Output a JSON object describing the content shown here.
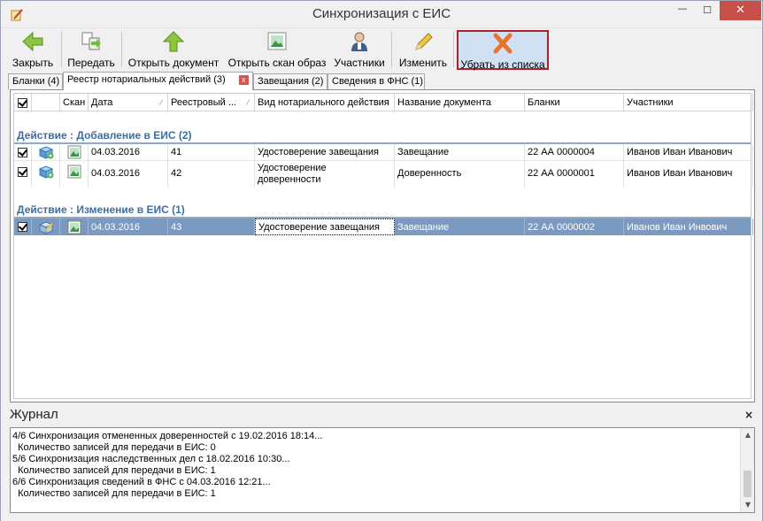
{
  "window": {
    "title": "Синхронизация с ЕИС",
    "controls": {
      "minimize": "—",
      "maximize": "☐",
      "close": "✕"
    }
  },
  "toolbar": {
    "buttons": [
      {
        "label": "Закрыть",
        "icon": "arrow-left-icon"
      },
      {
        "label": "Передать",
        "icon": "transfer-icon"
      },
      {
        "label": "Открыть документ",
        "icon": "arrow-up-icon"
      },
      {
        "label": "Открыть скан образ",
        "icon": "image-icon"
      },
      {
        "label": "Участники",
        "icon": "person-icon"
      },
      {
        "label": "Изменить",
        "icon": "pencil-icon"
      },
      {
        "label": "Убрать из списка",
        "icon": "red-x-icon"
      }
    ]
  },
  "tabs": [
    {
      "label": "Бланки (4)"
    },
    {
      "label": "Реестр нотариальных действий (3)",
      "active": true,
      "close": "x"
    },
    {
      "label": "Завещания (2)"
    },
    {
      "label": "Сведения в ФНС (1)"
    }
  ],
  "grid": {
    "columns": [
      "",
      "",
      "Скан",
      "Дата",
      "Реестровый ...",
      "Вид нотариального действия",
      "Название документа",
      "Бланки",
      "Участники"
    ],
    "groups": [
      {
        "title": "Действие : Добавление в ЕИС (2)",
        "rows": [
          {
            "date": "04.03.2016",
            "reg": "41",
            "action": "Удостоверение завещания",
            "doc": "Завещание",
            "blank": "22 АА 0000004",
            "participants": "Иванов Иван Иванович"
          },
          {
            "date": "04.03.2016",
            "reg": "42",
            "action": "Удостоверение доверенности",
            "doc": "Доверенность",
            "blank": "22 АА 0000001",
            "participants": "Иванов Иван Иванович"
          }
        ]
      },
      {
        "title": "Действие : Изменение в ЕИС (1)",
        "rows": [
          {
            "date": "04.03.2016",
            "reg": "43",
            "action": "Удостоверение завещания",
            "doc": "Завещание",
            "blank": "22 АА 0000002",
            "participants": "Иванов Иван Инвович"
          }
        ]
      }
    ]
  },
  "journal": {
    "title": "Журнал",
    "close": "×",
    "lines": [
      "4/6 Синхронизация отмененных доверенностей с 19.02.2016 18:14...",
      "  Количество записей для передачи в ЕИС: 0",
      "5/6 Синхронизация наследственных дел с 18.02.2016 10:30...",
      "  Количество записей для передачи в ЕИС: 1",
      "6/6 Синхронизация сведений в ФНС с 04.03.2016 12:21...",
      "  Количество записей для передачи в ЕИС: 1"
    ]
  },
  "colors": {
    "selection": "#7c99bf",
    "group_title": "#3a6ea5",
    "highlight_border": "#b0202b"
  }
}
